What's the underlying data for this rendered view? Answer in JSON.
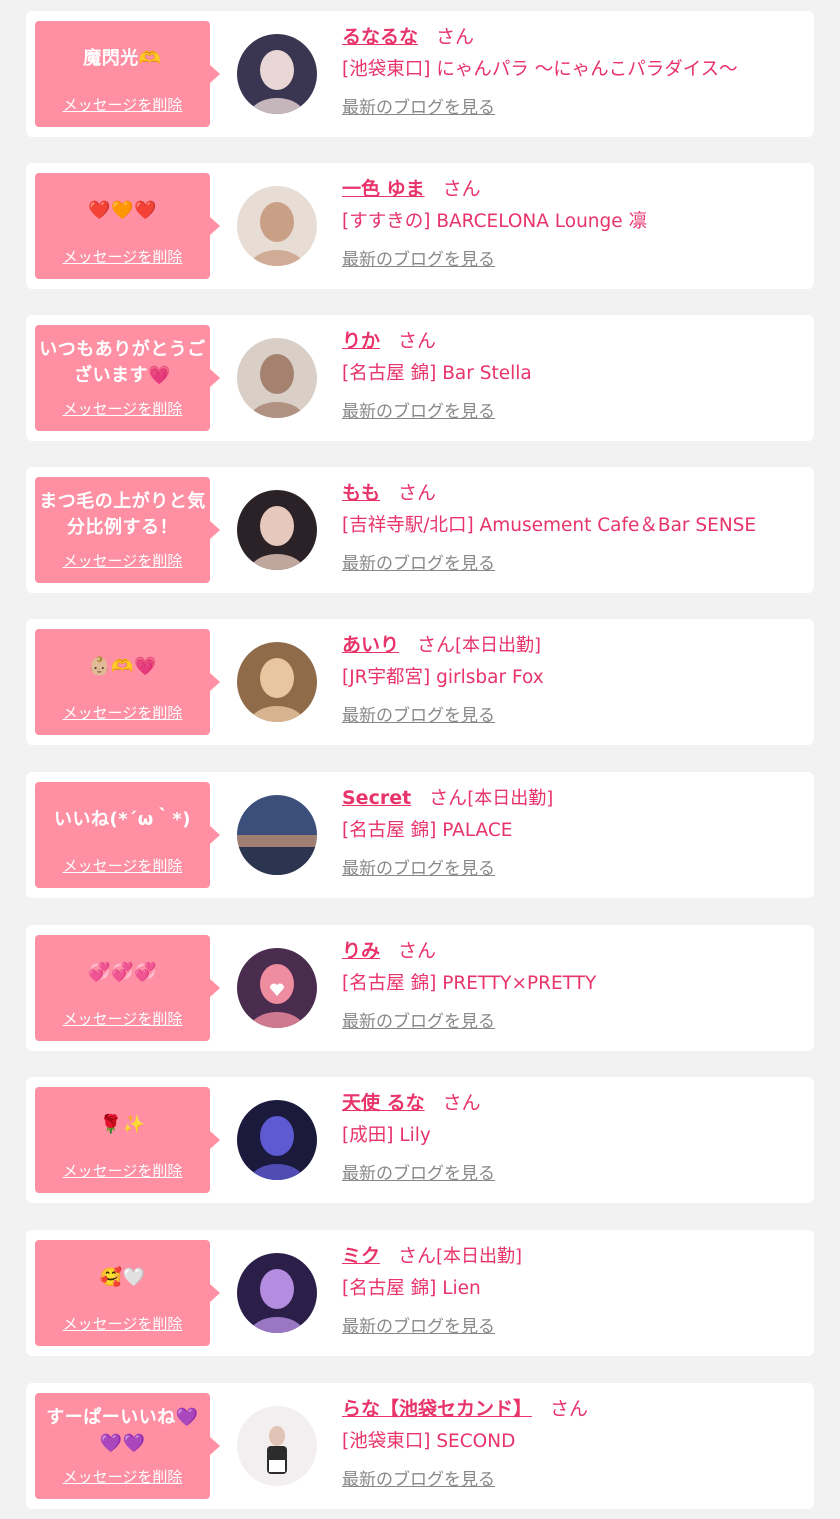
{
  "entries": [
    {
      "message": "魔閃光🫶",
      "delete_label": "メッセージを削除",
      "name": "るなるな",
      "honorific": "さん",
      "status": "",
      "shop": "[池袋東口] にゃんパラ 〜にゃんこパラダイス〜",
      "blog_link": "最新のブログを見る"
    },
    {
      "message": "❤️🧡❤️",
      "delete_label": "メッセージを削除",
      "name": "一色 ゆま",
      "honorific": "さん",
      "status": "",
      "shop": "[すすきの] BARCELONA Lounge 凛",
      "blog_link": "最新のブログを見る"
    },
    {
      "message": "いつもありがとうございます💗",
      "delete_label": "メッセージを削除",
      "name": "りか",
      "honorific": "さん",
      "status": "",
      "shop": "[名古屋 錦] Bar Stella",
      "blog_link": "最新のブログを見る"
    },
    {
      "message": "まつ毛の上がりと気分比例する！",
      "delete_label": "メッセージを削除",
      "name": "もも",
      "honorific": "さん",
      "status": "",
      "shop": "[吉祥寺駅/北口] Amusement Cafe＆Bar SENSE",
      "blog_link": "最新のブログを見る"
    },
    {
      "message": "👶🏼🫶💗",
      "delete_label": "メッセージを削除",
      "name": "あいり",
      "honorific": "さん",
      "status": "[本日出勤]",
      "shop": "[JR宇都宮] girlsbar Fox",
      "blog_link": "最新のブログを見る"
    },
    {
      "message": "いいね(*´ω｀*)",
      "delete_label": "メッセージを削除",
      "name": "Secret",
      "honorific": "さん",
      "status": "[本日出勤]",
      "shop": "[名古屋 錦] PALACE",
      "blog_link": "最新のブログを見る"
    },
    {
      "message": "💞💞💞",
      "delete_label": "メッセージを削除",
      "name": "りみ",
      "honorific": "さん",
      "status": "",
      "shop": "[名古屋 錦] PRETTY×PRETTY",
      "blog_link": "最新のブログを見る"
    },
    {
      "message": "🌹✨",
      "delete_label": "メッセージを削除",
      "name": "天使 るな",
      "honorific": "さん",
      "status": "",
      "shop": "[成田] Lily",
      "blog_link": "最新のブログを見る"
    },
    {
      "message": "🥰🤍",
      "delete_label": "メッセージを削除",
      "name": "ミク",
      "honorific": "さん",
      "status": "[本日出勤]",
      "shop": "[名古屋 錦] Lien",
      "blog_link": "最新のブログを見る"
    },
    {
      "message": "すーぱーいいね💜💜💜",
      "delete_label": "メッセージを削除",
      "name": "らな【池袋セカンド】",
      "honorific": "さん",
      "status": "",
      "shop": "[池袋東口] SECOND",
      "blog_link": "最新のブログを見る"
    }
  ],
  "avatar_colors": [
    [
      "#3a3550",
      "#e9d7d6"
    ],
    [
      "#e8ddd4",
      "#c99f86"
    ],
    [
      "#d9cfc6",
      "#a58170"
    ],
    [
      "#2a2226",
      "#e6c9bc"
    ],
    [
      "#8f6b4a",
      "#e8c6a0"
    ],
    [
      "#3b4f7a",
      "#f0a86c"
    ],
    [
      "#4a2c4f",
      "#ef8da0"
    ],
    [
      "#1b1a3d",
      "#5d5ad2"
    ],
    [
      "#2b1f4a",
      "#b58de0"
    ],
    [
      "#f3eef0",
      "#2c2c2c"
    ]
  ]
}
